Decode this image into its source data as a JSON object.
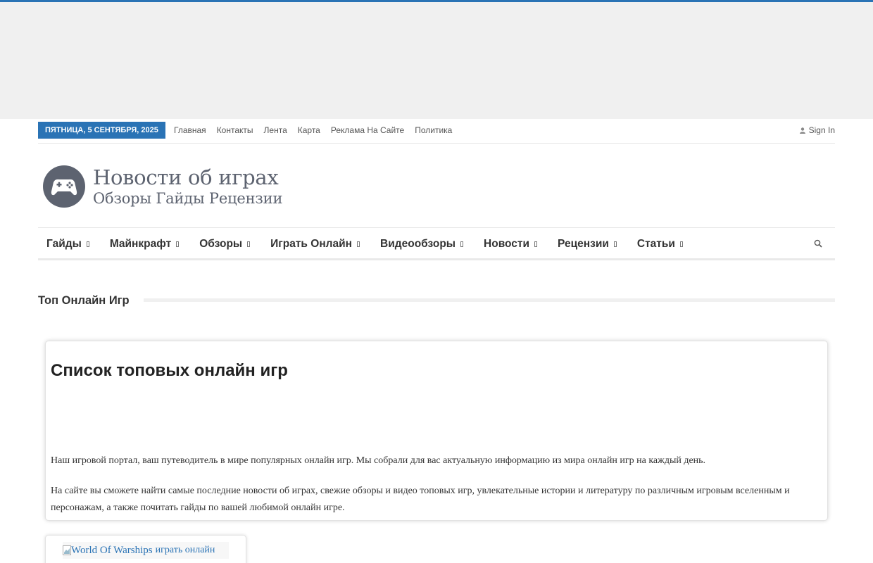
{
  "colors": {
    "accent": "#2a73b5",
    "ad_background": "#f0f0f0"
  },
  "topbar": {
    "date": "ПЯТНИЦА, 5 СЕНТЯБРЯ, 2025",
    "links": [
      "Главная",
      "Контакты",
      "Лента",
      "Карта",
      "Реклама На Сайте",
      "Политика"
    ],
    "signin_label": "Sign In",
    "signin_icon": "user-icon"
  },
  "header": {
    "logo_icon": "gamepad-icon",
    "logo_title": "Новости об играх",
    "logo_subtitle": "Обзоры Гайды Рецензии"
  },
  "nav": {
    "items": [
      "Гайды",
      "Майнкрафт",
      "Обзоры",
      "Играть Онлайн",
      "Видеообзоры",
      "Новости",
      "Рецензии",
      "Статьи"
    ],
    "caret_icon": "caret-down-icon",
    "search_icon": "search-icon"
  },
  "section": {
    "title": "Топ Онлайн Игр"
  },
  "card": {
    "title": "Список топовых онлайн игр",
    "paragraph1": "Наш игровой портал, ваш путеводитель в мире популярных онлайн игр. Мы собрали для вас актуальную информацию из мира онлайн игр на каждый день.",
    "paragraph2": "На сайте вы сможете найти самые последние новости об играх, свежие обзоры и видео топовых игр, увлекательные истории и литературу по различным игровым вселенным и персонажам, а также почитать гайды по вашей любимой онлайн игре."
  },
  "game_card": {
    "image_alt": "World Of Warships",
    "link_text": "играть онлайн"
  }
}
